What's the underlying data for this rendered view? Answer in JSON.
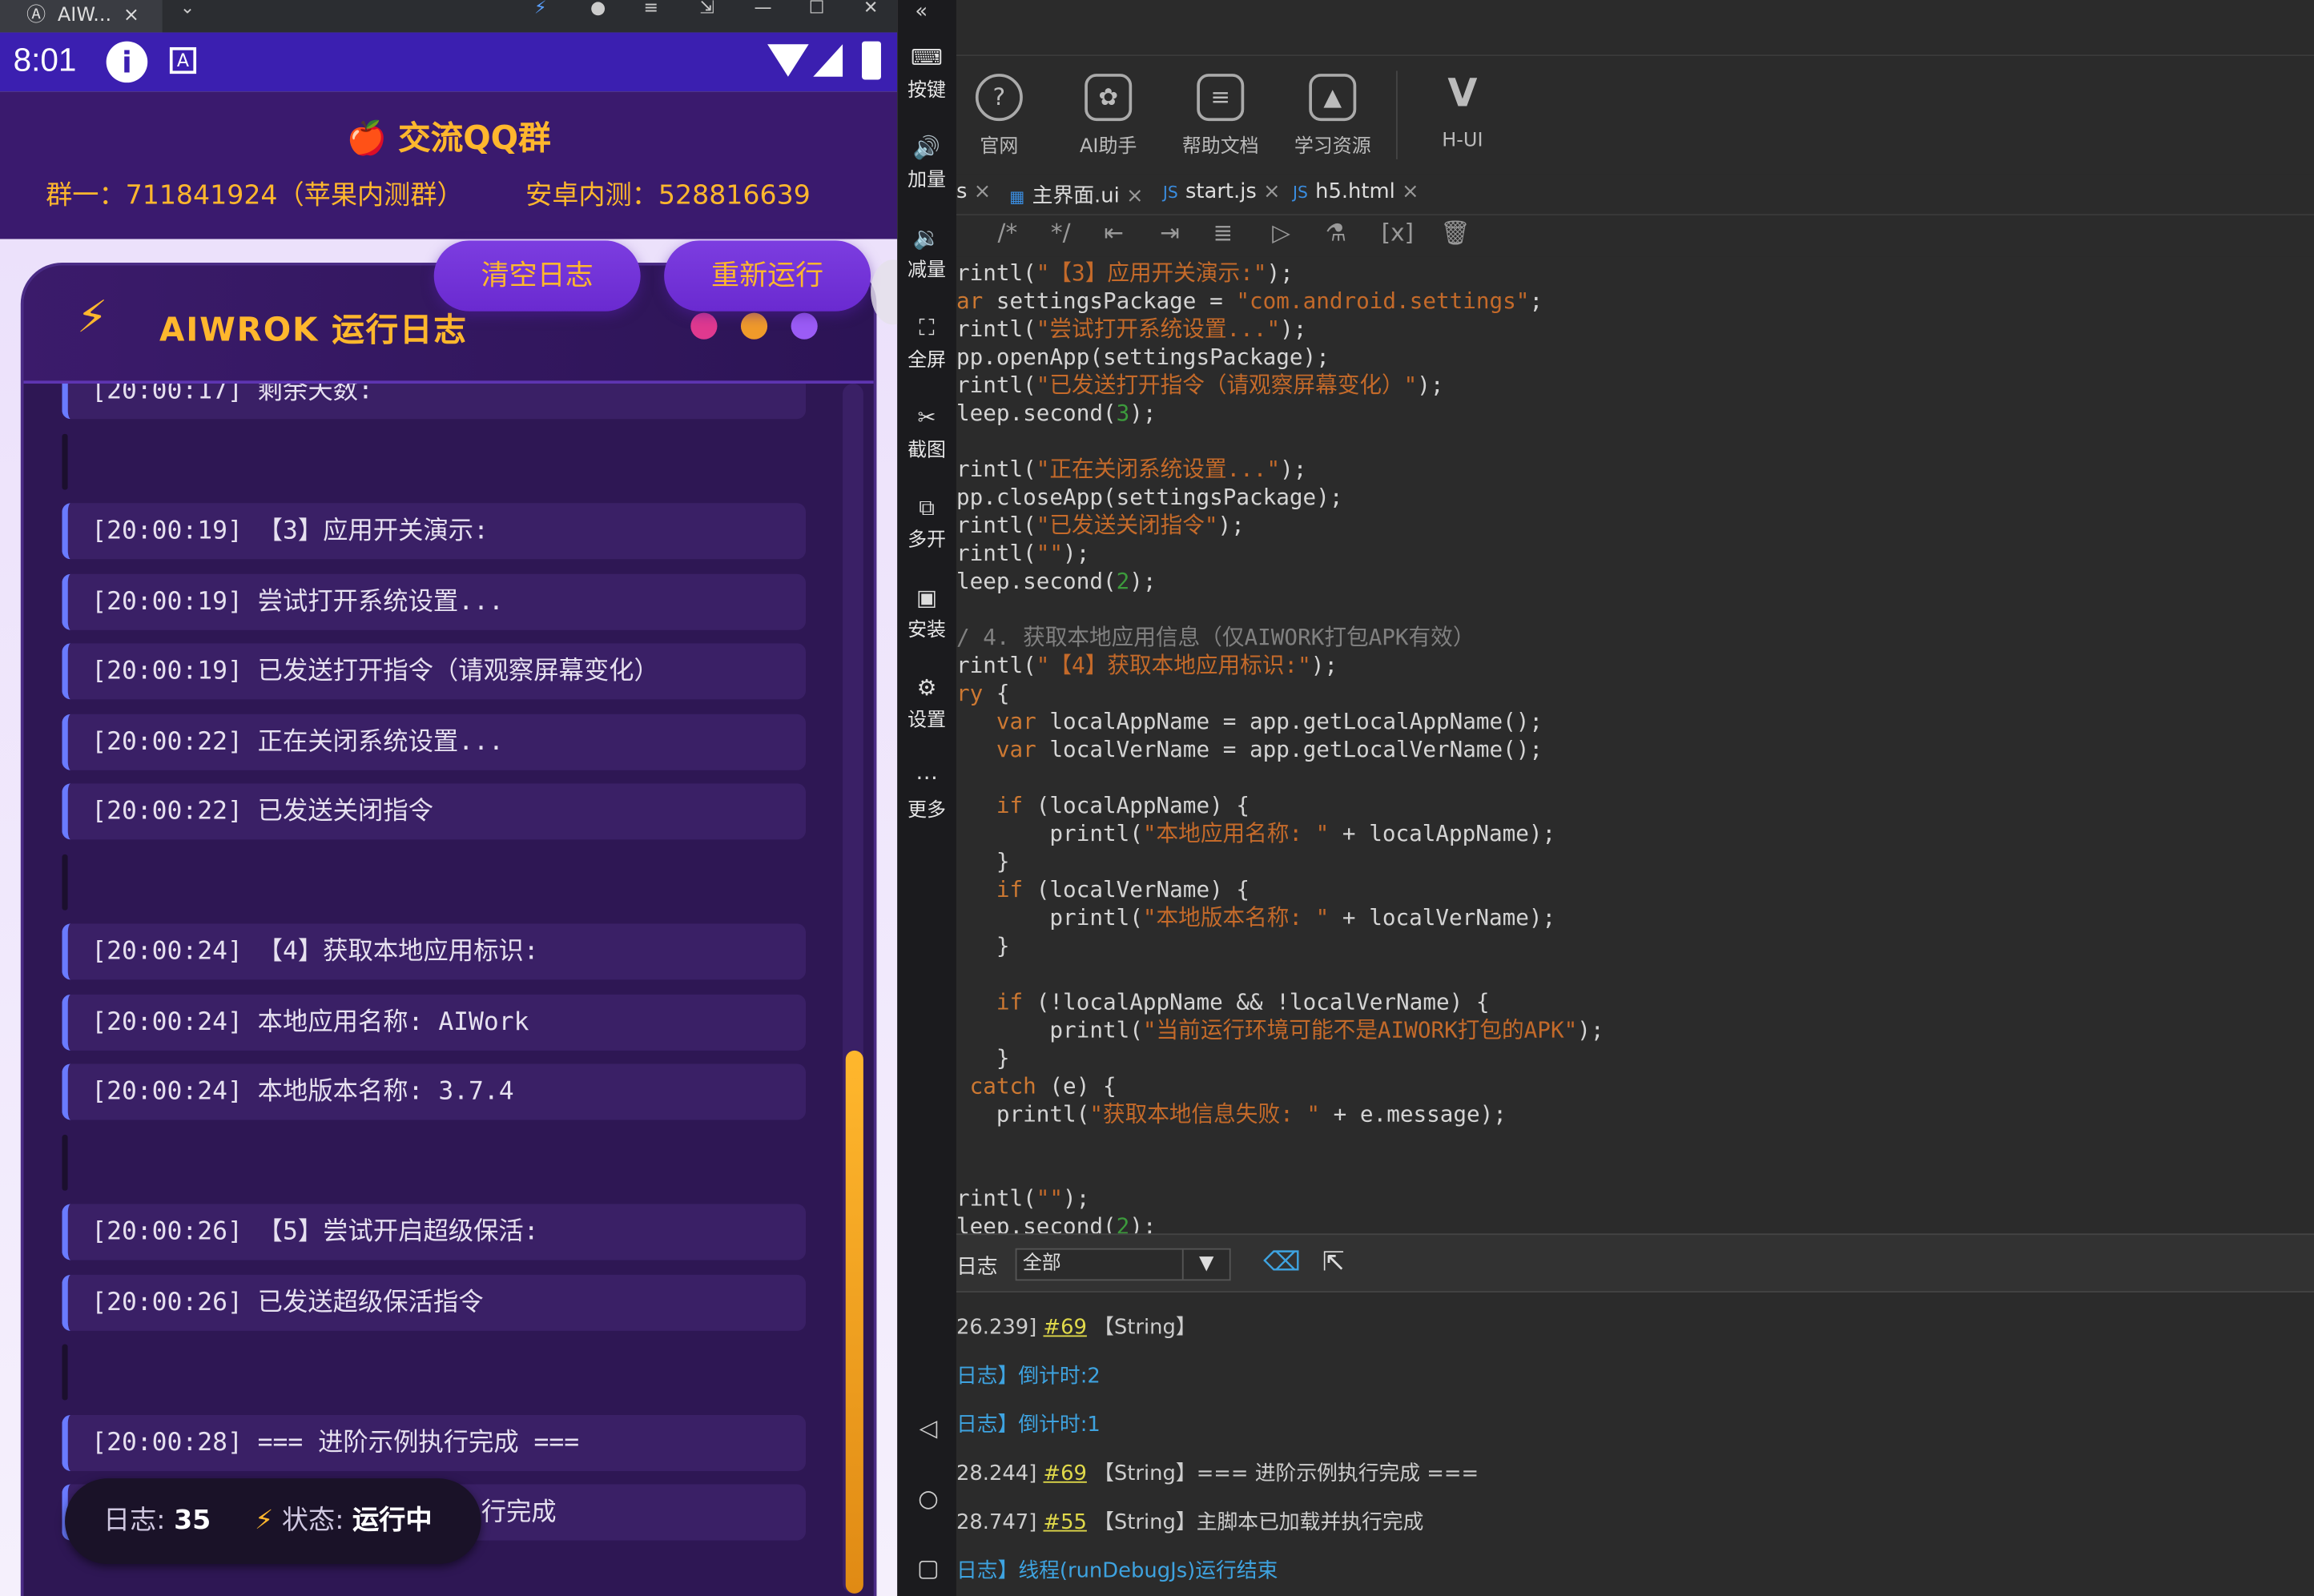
{
  "window_tab": {
    "title": "AIW...",
    "close": "×",
    "chevron": "⌄"
  },
  "status_bar": {
    "time": "8:01"
  },
  "qq": {
    "icon": "🍎",
    "title": "交流QQ群",
    "group1": "群一：711841924（苹果内测群）",
    "group2": "安卓内测：528816639"
  },
  "buttons": {
    "clear": "清空日志",
    "rerun": "重新运行"
  },
  "panel": {
    "icon": "⚡",
    "title": "AIWROK 运行日志"
  },
  "log_rows": [
    {
      "text": "[20:00:17] 剩余天数:"
    },
    {
      "text": ""
    },
    {
      "text": "[20:00:19] 【3】应用开关演示:"
    },
    {
      "text": "[20:00:19] 尝试打开系统设置..."
    },
    {
      "text": "[20:00:19] 已发送打开指令（请观察屏幕变化）"
    },
    {
      "text": "[20:00:22] 正在关闭系统设置..."
    },
    {
      "text": "[20:00:22] 已发送关闭指令"
    },
    {
      "text": ""
    },
    {
      "text": "[20:00:24] 【4】获取本地应用标识:"
    },
    {
      "text": "[20:00:24] 本地应用名称: AIWork"
    },
    {
      "text": "[20:00:24] 本地版本名称: 3.7.4"
    },
    {
      "text": ""
    },
    {
      "text": "[20:00:26] 【5】尝试开启超级保活:"
    },
    {
      "text": "[20:00:26] 已发送超级保活指令"
    },
    {
      "text": ""
    },
    {
      "text": "[20:00:28] === 进阶示例执行完成 ==="
    },
    {
      "text": "行完成"
    }
  ],
  "status_pill": {
    "log_label": "日志:",
    "log_count": "35",
    "icon": "⚡",
    "state_label": "状态:",
    "state_value": "运行中"
  },
  "side_toolbar": [
    {
      "label": "按键",
      "icon": "keyboard-icon",
      "glyph": "⌨"
    },
    {
      "label": "加量",
      "icon": "volume-up-icon",
      "glyph": "🔊"
    },
    {
      "label": "减量",
      "icon": "volume-down-icon",
      "glyph": "🔉"
    },
    {
      "label": "全屏",
      "icon": "fullscreen-icon",
      "glyph": "⛶"
    },
    {
      "label": "截图",
      "icon": "scissors-icon",
      "glyph": "✂"
    },
    {
      "label": "多开",
      "icon": "multi-open-icon",
      "glyph": "⧉"
    },
    {
      "label": "安装",
      "icon": "apk-icon",
      "glyph": "▣"
    },
    {
      "label": "设置",
      "icon": "settings-icon",
      "glyph": "⚙"
    },
    {
      "label": "更多",
      "icon": "more-icon",
      "glyph": "⋯"
    }
  ],
  "nav": {
    "back": "◁",
    "home": "○",
    "recent": "▢"
  },
  "ide_tools": [
    {
      "label": "官网",
      "icon": "help-circle-icon",
      "glyph": "?"
    },
    {
      "label": "AI助手",
      "icon": "ai-assistant-icon",
      "glyph": "✿"
    },
    {
      "label": "帮助文档",
      "icon": "document-icon",
      "glyph": "≡"
    },
    {
      "label": "学习资源",
      "icon": "graduation-cap-icon",
      "glyph": "▲"
    },
    {
      "label": "H-UI",
      "icon": "vue-logo-icon",
      "glyph": "V"
    }
  ],
  "file_tabs": [
    {
      "name": "s"
    },
    {
      "name": "主界面.ui"
    },
    {
      "name": "start.js"
    },
    {
      "name": "h5.html"
    }
  ],
  "code": [
    "rintl(\"【3】应用开关演示:\");",
    "ar settingsPackage = \"com.android.settings\";",
    "rintl(\"尝试打开系统设置...\");",
    "pp.openApp(settingsPackage);",
    "rintl(\"已发送打开指令（请观察屏幕变化）\");",
    "leep.second(3);",
    "",
    "rintl(\"正在关闭系统设置...\");",
    "pp.closeApp(settingsPackage);",
    "rintl(\"已发送关闭指令\");",
    "rintl(\"\");",
    "leep.second(2);",
    "",
    "/ 4. 获取本地应用信息（仅AIWORK打包APK有效）",
    "rintl(\"【4】获取本地应用标识:\");",
    "ry {",
    "   var localAppName = app.getLocalAppName();",
    "   var localVerName = app.getLocalVerName();",
    "",
    "   if (localAppName) {",
    "       printl(\"本地应用名称: \" + localAppName);",
    "   }",
    "   if (localVerName) {",
    "       printl(\"本地版本名称: \" + localVerName);",
    "   }",
    "",
    "   if (!localAppName && !localVerName) {",
    "       printl(\"当前运行环境可能不是AIWORK打包的APK\");",
    "   }",
    " catch (e) {",
    "   printl(\"获取本地信息失败: \" + e.message);",
    "",
    "",
    "rintl(\"\");",
    "leep.second(2);"
  ],
  "log_panel": {
    "label": "日志",
    "filter": "全部"
  },
  "console": [
    {
      "pre": "26.239]",
      "link": "#69",
      "post": "【String】",
      "kind": "normal"
    },
    {
      "pre": "日志】倒计时:2",
      "link": "",
      "post": "",
      "kind": "blue"
    },
    {
      "pre": "日志】倒计时:1",
      "link": "",
      "post": "",
      "kind": "blue"
    },
    {
      "pre": "28.244]",
      "link": "#69",
      "post": "【String】=== 进阶示例执行完成 ===",
      "kind": "normal"
    },
    {
      "pre": "28.747]",
      "link": "#55",
      "post": "【String】主脚本已加载并执行完成",
      "kind": "normal"
    },
    {
      "pre": "日志】线程(runDebugJs)运行结束",
      "link": "",
      "post": "",
      "kind": "blue"
    }
  ]
}
